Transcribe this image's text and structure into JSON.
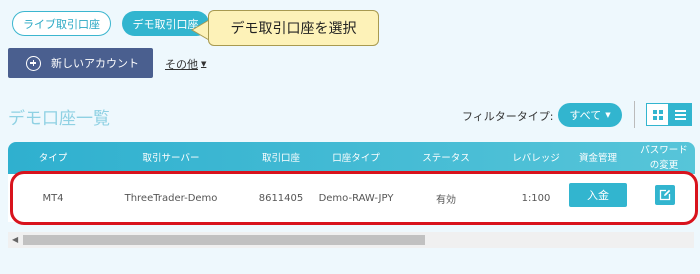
{
  "tabs": {
    "live": "ライブ取引口座",
    "demo": "デモ取引口座"
  },
  "callout": "デモ取引口座を選択",
  "actions": {
    "new_account": "新しいアカウント",
    "other": "その他"
  },
  "section": {
    "title": "デモ口座一覧",
    "filter_label": "フィルタータイプ:",
    "filter_value": "すべて"
  },
  "table": {
    "headers": [
      "タイプ",
      "取引サーバー",
      "取引口座",
      "口座タイプ",
      "ステータス",
      "レバレッジ",
      "資金管理",
      "パスワード\nの変更"
    ],
    "row": {
      "type": "MT4",
      "server": "ThreeTrader-Demo",
      "account": "8611405",
      "account_type": "Demo-RAW-JPY",
      "status": "有効",
      "leverage": "1:100",
      "deposit_label": "入金"
    }
  },
  "icons": {
    "new_account": "plus-circle-icon",
    "other_dropdown": "caret-down-icon",
    "filter_dropdown": "caret-down-icon",
    "grid_view": "grid-icon",
    "list_view": "list-icon",
    "edit_password": "edit-icon",
    "scroll_left": "arrow-left-icon"
  },
  "colors": {
    "accent": "#32b5cf",
    "new_button": "#4a5f8f",
    "highlight": "#d8131d",
    "callout_bg": "#fdf2b8",
    "title": "#8fd1e3"
  }
}
